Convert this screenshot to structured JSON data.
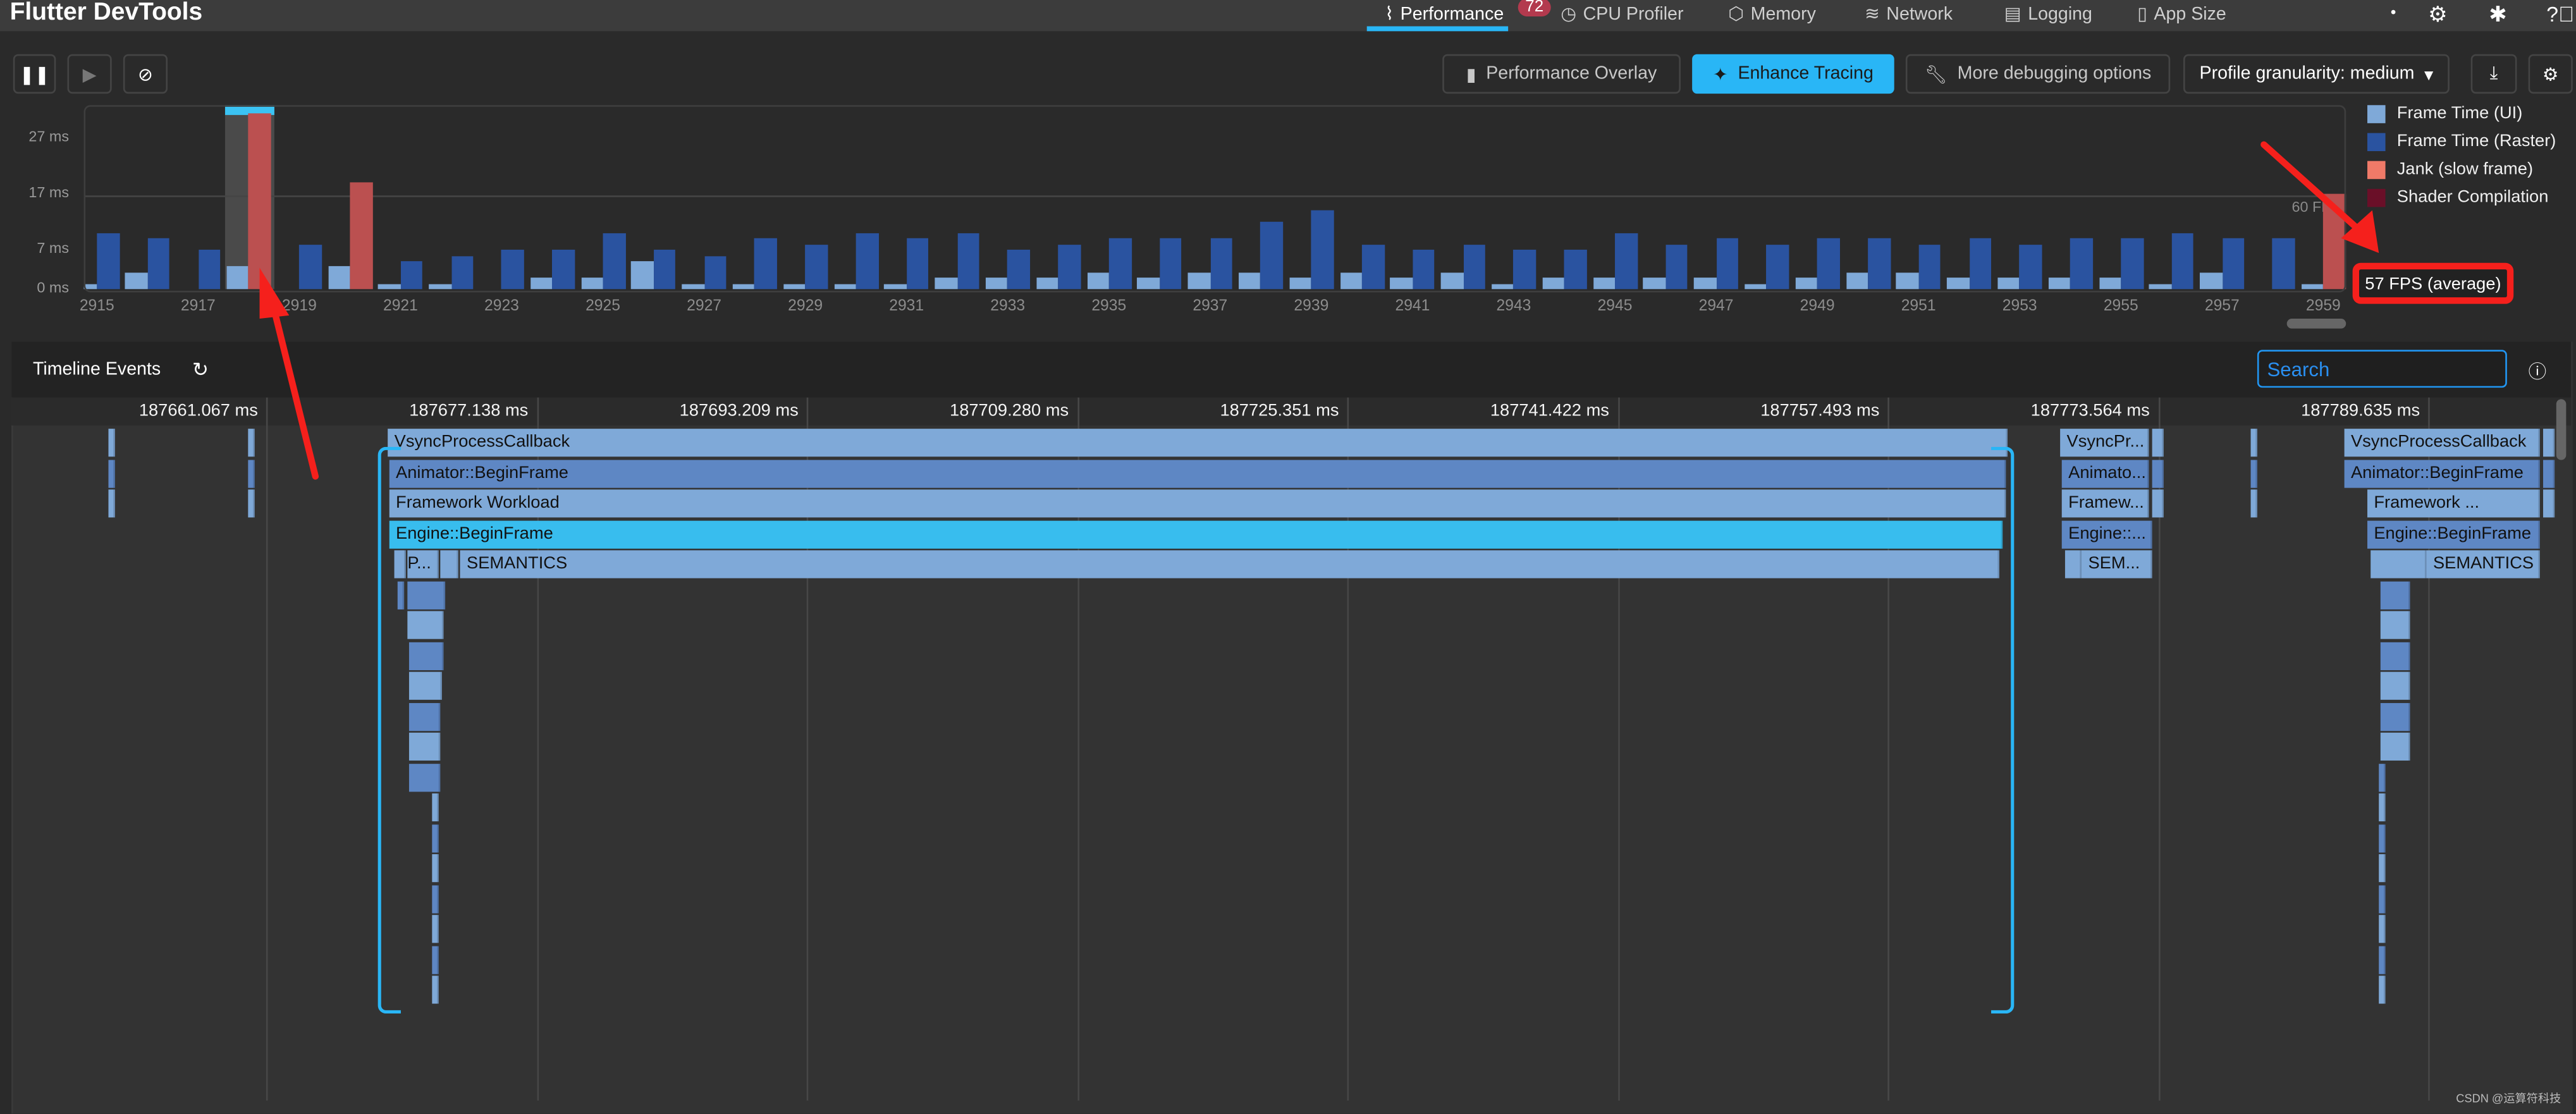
{
  "header": {
    "title": "Flutter DevTools",
    "tabs": [
      {
        "label": "Performance",
        "icon": "pulse-icon",
        "active": true,
        "badge": "72"
      },
      {
        "label": "CPU Profiler",
        "icon": "timer-icon"
      },
      {
        "label": "Memory",
        "icon": "memory-icon"
      },
      {
        "label": "Network",
        "icon": "wifi-icon"
      },
      {
        "label": "Logging",
        "icon": "log-icon"
      },
      {
        "label": "App Size",
        "icon": "file-icon"
      }
    ],
    "right_icons": [
      "dot-icon",
      "gear-icon",
      "bug-icon",
      "help-icon"
    ]
  },
  "toolbar": {
    "pause_icon": "pause-icon",
    "play_icon": "play-icon",
    "clear_icon": "clear-icon",
    "performance_overlay": "Performance Overlay",
    "enhance_tracing": "Enhance Tracing",
    "more_debugging": "More debugging options",
    "profile_granularity": "Profile granularity: medium",
    "accent": "#29b6f6"
  },
  "chart_data": {
    "type": "bar",
    "categories": [
      2915,
      2916,
      2917,
      2918,
      2919,
      2920,
      2921,
      2922,
      2923,
      2924,
      2925,
      2926,
      2927,
      2928,
      2929,
      2930,
      2931,
      2932,
      2933,
      2934,
      2935,
      2936,
      2937,
      2938,
      2939,
      2940,
      2941,
      2942,
      2943,
      2944,
      2945,
      2946,
      2947,
      2948,
      2949,
      2950,
      2951,
      2952,
      2953,
      2954,
      2955,
      2956,
      2957,
      2958,
      2959
    ],
    "tick_labels": [
      "2915",
      "2917",
      "2919",
      "2921",
      "2923",
      "2925",
      "2927",
      "2929",
      "2931",
      "2933",
      "2935",
      "2937",
      "2939",
      "2941",
      "2943",
      "2945",
      "2947",
      "2949",
      "2951",
      "2953",
      "2955",
      "2957",
      "2959"
    ],
    "series": [
      {
        "name": "Frame Time (UI)",
        "color": "#7fa9d8",
        "values": [
          1,
          3,
          0,
          4,
          0,
          4,
          1,
          1,
          0,
          2,
          2,
          5,
          1,
          1,
          1,
          1,
          1,
          2,
          2,
          2,
          3,
          2,
          3,
          3,
          2,
          3,
          2,
          3,
          1,
          2,
          2,
          2,
          2,
          1,
          2,
          3,
          3,
          2,
          2,
          2,
          2,
          1,
          3,
          0,
          1
        ]
      },
      {
        "name": "Frame Time (Raster)",
        "color": "#2a53a0",
        "values": [
          10,
          9,
          7,
          31.5,
          8,
          19,
          5,
          6,
          7,
          7,
          10,
          7,
          6,
          9,
          8,
          10,
          9,
          10,
          7,
          8,
          9,
          9,
          9,
          12,
          14,
          8,
          7,
          8,
          7,
          7,
          10,
          8,
          9,
          8,
          9,
          9,
          8,
          9,
          8,
          9,
          9,
          10,
          9,
          9,
          17
        ]
      }
    ],
    "jank_frames": [
      2918,
      2920,
      2959
    ],
    "selected_frame": 2918,
    "legend": [
      {
        "label": "Frame Time (UI)",
        "color": "#7fa9d8"
      },
      {
        "label": "Frame Time (Raster)",
        "color": "#2a53a0"
      },
      {
        "label": "Jank (slow frame)",
        "color": "#f07a68"
      },
      {
        "label": "Shader Compilation",
        "color": "#6a0f28"
      }
    ],
    "legend_position": "right",
    "y_ticks": [
      {
        "v": 0,
        "label": "0 ms"
      },
      {
        "v": 7,
        "label": "7 ms"
      },
      {
        "v": 17,
        "label": "17 ms"
      },
      {
        "v": 27,
        "label": "27 ms"
      }
    ],
    "ylim": [
      0,
      33
    ],
    "target_line": {
      "value": 16.67,
      "label": "60 FPS"
    },
    "jank_color": "#bb5050",
    "average_fps": "57 FPS (average)"
  },
  "timeline": {
    "title": "Timeline Events",
    "refresh_icon": "refresh-icon",
    "search_placeholder": "Search",
    "help_icon": "help-icon",
    "ruler": [
      "187661.067 ms",
      "187677.138 ms",
      "187693.209 ms",
      "187709.280 ms",
      "187725.351 ms",
      "187741.422 ms",
      "187757.493 ms",
      "187773.564 ms",
      "187789.635 ms"
    ],
    "events": [
      {
        "row": 0,
        "start": 187651.69,
        "end": 187652.08
      },
      {
        "row": 1,
        "start": 187651.69,
        "end": 187652.08
      },
      {
        "row": 2,
        "start": 187651.69,
        "end": 187652.08
      },
      {
        "row": 0,
        "start": 187659.99,
        "end": 187660.38
      },
      {
        "row": 1,
        "start": 187659.99,
        "end": 187660.38
      },
      {
        "row": 2,
        "start": 187659.99,
        "end": 187660.38
      },
      {
        "row": 0,
        "start": 187668.3,
        "end": 187764.62,
        "name": "VsyncProcessCallback"
      },
      {
        "row": 1,
        "start": 187668.39,
        "end": 187764.52,
        "name": "Animator::BeginFrame"
      },
      {
        "row": 2,
        "start": 187668.39,
        "end": 187764.52,
        "name": "Framework Workload"
      },
      {
        "row": 3,
        "start": 187668.39,
        "end": 187764.33,
        "name": "Engine::BeginFrame",
        "selected": true
      },
      {
        "row": 4,
        "start": 187668.69,
        "end": 187669.37
      },
      {
        "row": 4,
        "start": 187669.47,
        "end": 187671.33,
        "name": "P..."
      },
      {
        "row": 4,
        "start": 187671.43,
        "end": 187672.5
      },
      {
        "row": 4,
        "start": 187672.6,
        "end": 187764.14,
        "name": "SEMANTICS"
      },
      {
        "row": 5,
        "start": 187668.88,
        "end": 187669.27
      },
      {
        "row": 5,
        "start": 187669.47,
        "end": 187671.72
      },
      {
        "row": 6,
        "start": 187669.47,
        "end": 187671.62
      },
      {
        "row": 7,
        "start": 187669.57,
        "end": 187671.62
      },
      {
        "row": 8,
        "start": 187669.57,
        "end": 187671.52
      },
      {
        "row": 9,
        "start": 187669.57,
        "end": 187671.43
      },
      {
        "row": 10,
        "start": 187669.57,
        "end": 187671.43
      },
      {
        "row": 11,
        "start": 187669.57,
        "end": 187671.43
      },
      {
        "row": 12,
        "start": 187670.93,
        "end": 187671.33
      },
      {
        "row": 13,
        "start": 187670.93,
        "end": 187671.33
      },
      {
        "row": 14,
        "start": 187670.93,
        "end": 187671.33
      },
      {
        "row": 15,
        "start": 187670.93,
        "end": 187671.33
      },
      {
        "row": 16,
        "start": 187670.93,
        "end": 187671.33
      },
      {
        "row": 17,
        "start": 187670.93,
        "end": 187671.33
      },
      {
        "row": 18,
        "start": 187670.93,
        "end": 187671.33
      },
      {
        "row": 0,
        "start": 187767.75,
        "end": 187773.03,
        "name": "VsyncPr..."
      },
      {
        "row": 1,
        "start": 187767.85,
        "end": 187773.03,
        "name": "Animato..."
      },
      {
        "row": 2,
        "start": 187767.85,
        "end": 187773.03,
        "name": "Framew..."
      },
      {
        "row": 3,
        "start": 187767.85,
        "end": 187773.22,
        "name": "Engine::..."
      },
      {
        "row": 4,
        "start": 187768.05,
        "end": 187769.03
      },
      {
        "row": 4,
        "start": 187769.03,
        "end": 187773.22,
        "name": "SEM..."
      },
      {
        "row": 0,
        "start": 187773.22,
        "end": 187773.91
      },
      {
        "row": 1,
        "start": 187773.22,
        "end": 187773.91
      },
      {
        "row": 2,
        "start": 187773.22,
        "end": 187773.91
      },
      {
        "row": 0,
        "start": 187779.08,
        "end": 187779.48
      },
      {
        "row": 1,
        "start": 187779.08,
        "end": 187779.48
      },
      {
        "row": 2,
        "start": 187779.08,
        "end": 187779.48
      },
      {
        "row": 0,
        "start": 187784.65,
        "end": 187796.28,
        "name": "VsyncProcessCallback"
      },
      {
        "row": 1,
        "start": 187784.65,
        "end": 187796.28,
        "name": "Animator::BeginFrame"
      },
      {
        "row": 2,
        "start": 187786.02,
        "end": 187796.28,
        "name": "Framework ..."
      },
      {
        "row": 3,
        "start": 187786.02,
        "end": 187796.28,
        "name": "Engine::BeginFrame"
      },
      {
        "row": 4,
        "start": 187786.22,
        "end": 187789.54
      },
      {
        "row": 4,
        "start": 187789.54,
        "end": 187796.28,
        "name": "SEMANTICS"
      },
      {
        "row": 0,
        "start": 187796.47,
        "end": 187797.16
      },
      {
        "row": 1,
        "start": 187796.47,
        "end": 187797.16
      },
      {
        "row": 2,
        "start": 187796.47,
        "end": 187797.16
      },
      {
        "row": 5,
        "start": 187786.8,
        "end": 187788.56
      },
      {
        "row": 6,
        "start": 187786.8,
        "end": 187788.56
      },
      {
        "row": 7,
        "start": 187786.8,
        "end": 187788.56
      },
      {
        "row": 8,
        "start": 187786.8,
        "end": 187788.56
      },
      {
        "row": 9,
        "start": 187786.8,
        "end": 187788.56
      },
      {
        "row": 10,
        "start": 187786.8,
        "end": 187788.56
      },
      {
        "row": 11,
        "start": 187786.71,
        "end": 187787.1
      },
      {
        "row": 12,
        "start": 187786.71,
        "end": 187787.1
      },
      {
        "row": 13,
        "start": 187786.71,
        "end": 187787.1
      },
      {
        "row": 14,
        "start": 187786.71,
        "end": 187787.1
      },
      {
        "row": 15,
        "start": 187786.71,
        "end": 187787.1
      },
      {
        "row": 16,
        "start": 187786.71,
        "end": 187787.1
      },
      {
        "row": 17,
        "start": 187786.71,
        "end": 187787.1
      },
      {
        "row": 18,
        "start": 187786.71,
        "end": 187787.1
      }
    ],
    "colors": {
      "light": "#7fa9d8",
      "dark": "#5e87c4",
      "selected": "#38bdee"
    }
  },
  "watermark": "CSDN @运算符科技"
}
